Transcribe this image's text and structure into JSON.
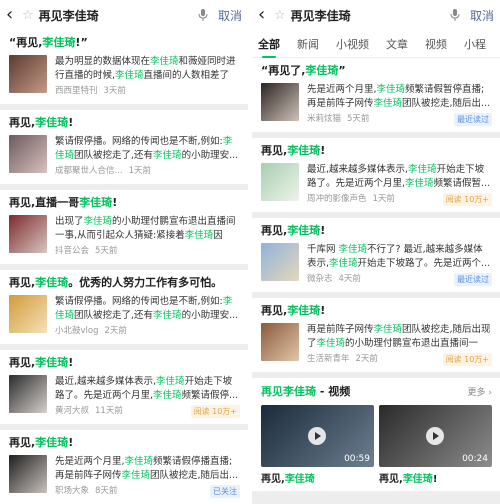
{
  "hl_color": "#07c160",
  "left": {
    "back_glyph": "‹",
    "star_glyph": "☆",
    "query": "再见李佳琦",
    "cancel_label": "取消",
    "cards": [
      {
        "title": [
          {
            "t": "“再见,",
            "h": false
          },
          {
            "t": "李佳琦",
            "h": true
          },
          {
            "t": "!”",
            "h": false
          }
        ],
        "snippet": [
          {
            "t": "最为明显的数据体现在",
            "h": false
          },
          {
            "t": "李佳琦",
            "h": true
          },
          {
            "t": "和薇娅同时进行直播的时候,",
            "h": false
          },
          {
            "t": "李佳琦",
            "h": true
          },
          {
            "t": "直播间的人数相差了一...",
            "h": false
          }
        ],
        "source": "西西里特刊",
        "time": "3天前",
        "badge": null,
        "thumb": [
          "#5a3b32",
          "#c49a84"
        ]
      },
      {
        "title": [
          {
            "t": "再见,",
            "h": false
          },
          {
            "t": "李佳琦",
            "h": true
          },
          {
            "t": "!",
            "h": false
          }
        ],
        "snippet": [
          {
            "t": "繁请假停播。网络的传闻也是不断,例如:",
            "h": false
          },
          {
            "t": "李佳琦",
            "h": true
          },
          {
            "t": "团队被挖走了,还有",
            "h": false
          },
          {
            "t": "李佳琦",
            "h": true
          },
          {
            "t": "的小助理安...",
            "h": false
          }
        ],
        "source": "成都聚世人合信...",
        "time": "1天前",
        "badge": null,
        "thumb": [
          "#6b5a5d",
          "#d9c1bd"
        ]
      },
      {
        "title": [
          {
            "t": "再见,直播一哥",
            "h": false
          },
          {
            "t": "李佳琦",
            "h": true
          },
          {
            "t": "!",
            "h": false
          }
        ],
        "snippet": [
          {
            "t": "出现了",
            "h": false
          },
          {
            "t": "李佳琦",
            "h": true
          },
          {
            "t": "的小助理付鹏宣布退出直播间一事,从而引起众人猜疑:紧接着",
            "h": false
          },
          {
            "t": "李佳琦",
            "h": true
          },
          {
            "t": "因在...",
            "h": false
          }
        ],
        "source": "抖音公会",
        "time": "5天前",
        "badge": null,
        "thumb": [
          "#7d2a2d",
          "#d8c6c0"
        ]
      },
      {
        "title": [
          {
            "t": "再见,",
            "h": false
          },
          {
            "t": "李佳琦",
            "h": true
          },
          {
            "t": "。优秀的人努力工作有多可怕。",
            "h": false
          }
        ],
        "snippet": [
          {
            "t": "繁请假停播。网络的传闻也是不断,例如:",
            "h": false
          },
          {
            "t": "李佳琦",
            "h": true
          },
          {
            "t": "团队被挖走了,还有",
            "h": false
          },
          {
            "t": "李佳琦",
            "h": true
          },
          {
            "t": "的小助理安...",
            "h": false
          }
        ],
        "source": "小北鼓vlog",
        "time": "2天前",
        "badge": null,
        "thumb": [
          "#d49a3a",
          "#f4e2b8"
        ]
      },
      {
        "title": [
          {
            "t": "再见,",
            "h": false
          },
          {
            "t": "李佳琦",
            "h": true
          },
          {
            "t": "!",
            "h": false
          }
        ],
        "snippet": [
          {
            "t": "最近,越来越多媒体表示,",
            "h": false
          },
          {
            "t": "李佳琦",
            "h": true
          },
          {
            "t": "开始走下坡路了。先是近两个月里,",
            "h": false
          },
          {
            "t": "李佳琦",
            "h": true
          },
          {
            "t": "频繁请假停...",
            "h": false
          }
        ],
        "source": "黄河大叔",
        "time": "11天前",
        "badge": {
          "text": "阅读 10万+",
          "kind": "read"
        },
        "thumb": [
          "#2b2b2b",
          "#d6d0cc"
        ]
      },
      {
        "title": [
          {
            "t": "再见,",
            "h": false
          },
          {
            "t": "李佳琦",
            "h": true
          },
          {
            "t": "!",
            "h": false
          }
        ],
        "snippet": [
          {
            "t": "先是近两个月里,",
            "h": false
          },
          {
            "t": "李佳琦",
            "h": true
          },
          {
            "t": "频繁请假停播直播;再是前阵子网传",
            "h": false
          },
          {
            "t": "李佳琦",
            "h": true
          },
          {
            "t": "团队被挖走,随后出...",
            "h": false
          }
        ],
        "source": "职场大象",
        "time": "8天前",
        "badge": {
          "text": "已关注",
          "kind": "seen"
        },
        "thumb": [
          "#1f1f1f",
          "#c9c2bd"
        ]
      }
    ]
  },
  "right": {
    "back_glyph": "‹",
    "star_glyph": "☆",
    "query": "再见李佳琦",
    "cancel_label": "取消",
    "tabs": [
      "全部",
      "新闻",
      "小视频",
      "文章",
      "视频",
      "小程"
    ],
    "cards": [
      {
        "title": [
          {
            "t": "“再见了,",
            "h": false
          },
          {
            "t": "李佳琦",
            "h": true
          },
          {
            "t": "”",
            "h": false
          }
        ],
        "snippet": [
          {
            "t": "先是近两个月里,",
            "h": false
          },
          {
            "t": "李佳琦",
            "h": true
          },
          {
            "t": "频繁请假暂停直播;再是前阵子网传",
            "h": false
          },
          {
            "t": "李佳琦",
            "h": true
          },
          {
            "t": "团队被挖走,随后出...",
            "h": false
          }
        ],
        "source": "米莉炫猫",
        "time": "5天前",
        "badge": {
          "text": "最近读过",
          "kind": "seen"
        },
        "thumb": [
          "#2c2422",
          "#cfc3bb"
        ]
      },
      {
        "title": [
          {
            "t": "再见,",
            "h": false
          },
          {
            "t": "李佳琦",
            "h": true
          },
          {
            "t": "!",
            "h": false
          }
        ],
        "snippet": [
          {
            "t": "最近,越来越多媒体表示,",
            "h": false
          },
          {
            "t": "李佳琦",
            "h": true
          },
          {
            "t": "开始走下坡路了。先是近两个月里,",
            "h": false
          },
          {
            "t": "李佳琦",
            "h": true
          },
          {
            "t": "频繁请假暂...",
            "h": false
          }
        ],
        "source": "周冲的影像声色",
        "time": "1天前",
        "badge": {
          "text": "阅读 10万+",
          "kind": "read"
        },
        "thumb": [
          "#a7cfb0",
          "#eef3ea"
        ]
      },
      {
        "title": [
          {
            "t": "再见,",
            "h": false
          },
          {
            "t": "李佳琦",
            "h": true
          },
          {
            "t": "!",
            "h": false
          }
        ],
        "snippet": [
          {
            "t": "千库网 ",
            "h": false
          },
          {
            "t": "李佳琦",
            "h": true
          },
          {
            "t": "不行了? 最近,越来越多媒体表示,",
            "h": false
          },
          {
            "t": "李佳琦",
            "h": true
          },
          {
            "t": "开始走下坡路了。先是近两个...",
            "h": false
          }
        ],
        "source": "微杂志",
        "time": "4天前",
        "badge": {
          "text": "最近读过",
          "kind": "seen"
        },
        "thumb": [
          "#8fb3d9",
          "#e5d7bd"
        ]
      },
      {
        "title": [
          {
            "t": "再见,",
            "h": false
          },
          {
            "t": "李佳琦",
            "h": true
          },
          {
            "t": "!",
            "h": false
          }
        ],
        "snippet": [
          {
            "t": "再是前阵子网传",
            "h": false
          },
          {
            "t": "李佳琦",
            "h": true
          },
          {
            "t": "团队被挖走,随后出现了",
            "h": false
          },
          {
            "t": "李佳琦",
            "h": true
          },
          {
            "t": "的小助理付鹏宣布退出直播间一事...",
            "h": false
          }
        ],
        "source": "生活新青年",
        "time": "2天前",
        "badge": {
          "text": "阅读 10万+",
          "kind": "read"
        },
        "thumb": [
          "#8a5a3c",
          "#e2c6a8"
        ]
      }
    ],
    "video_section": {
      "title_q": "再见李佳琦",
      "title_rest": " - 视频",
      "more": "更多 ›",
      "videos": [
        {
          "duration": "00:59",
          "title": [
            {
              "t": "再见,",
              "h": false
            },
            {
              "t": "李佳琦",
              "h": true
            }
          ],
          "thumb": [
            "#1a2a3a",
            "#6d7f90"
          ]
        },
        {
          "duration": "00:24",
          "title": [
            {
              "t": "再见,",
              "h": false
            },
            {
              "t": "李佳琦",
              "h": true
            },
            {
              "t": "!",
              "h": false
            }
          ],
          "thumb": [
            "#2a2a2a",
            "#8c8c8c"
          ]
        }
      ]
    }
  }
}
